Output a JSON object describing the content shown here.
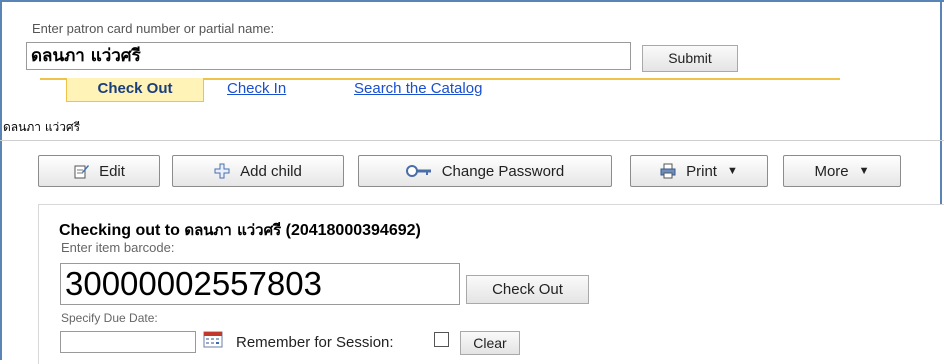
{
  "search": {
    "prompt": "Enter patron card number or partial name:",
    "value": "ดลนภา แว่วศรี",
    "submit_label": "Submit"
  },
  "tabs": [
    {
      "label": "Check Out",
      "active": true
    },
    {
      "label": "Check In",
      "active": false
    },
    {
      "label": "Search the Catalog",
      "active": false
    }
  ],
  "patron": {
    "name": "ดลนภา แว่วศรี"
  },
  "toolbar": {
    "edit_label": "Edit",
    "add_child_label": "Add child",
    "change_password_label": "Change Password",
    "print_label": "Print",
    "more_label": "More"
  },
  "checkout": {
    "heading_prefix": "Checking out to",
    "heading_name": "ดลนภา แว่วศรี",
    "heading_card": "(20418000394692)",
    "barcode_label": "Enter item barcode:",
    "barcode_value": "30000002557803",
    "checkout_label": "Check Out",
    "due_label": "Specify Due Date:",
    "due_value": "",
    "remember_label": "Remember for Session:",
    "remember_checked": false,
    "clear_label": "Clear"
  },
  "colors": {
    "frame": "#5a84b5",
    "tab_active_bg": "#fff3b8",
    "tab_border": "#f0c24a",
    "link": "#1a4fd0"
  }
}
